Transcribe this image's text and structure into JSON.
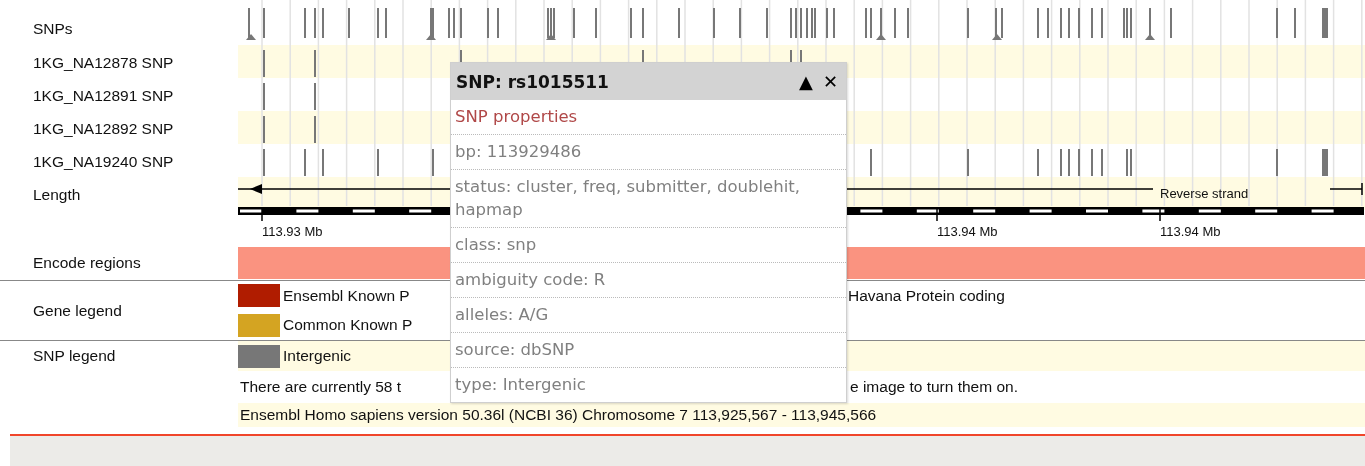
{
  "tracks": [
    {
      "label": "SNPs"
    },
    {
      "label": "1KG_NA12878 SNP"
    },
    {
      "label": "1KG_NA12891 SNP"
    },
    {
      "label": "1KG_NA12892 SNP"
    },
    {
      "label": "1KG_NA19240 SNP"
    },
    {
      "label": "Length"
    }
  ],
  "strand_note": "Reverse strand",
  "scale_labels": [
    "113.93 Mb",
    "113.94 Mb",
    "113.94 Mb"
  ],
  "encode": {
    "label": "Encode regions"
  },
  "gene_legend": {
    "label": "Gene legend",
    "items": [
      {
        "left": "Ensembl Known P",
        "right": "Havana Protein coding",
        "color": "#b01c00"
      },
      {
        "left": "Common Known P",
        "color": "#d4a422"
      }
    ]
  },
  "snp_legend": {
    "label": "SNP legend",
    "items": [
      {
        "left": "Intergenic",
        "color": "#777777"
      }
    ]
  },
  "notice": {
    "left": "There are currently 58 t",
    "right": "e image to turn them on."
  },
  "footer": "Ensembl Homo sapiens version 50.36l (NCBI 36) Chromosome 7  113,925,567 - 113,945,566",
  "popup": {
    "title": "SNP: rs1015511",
    "collapse": "▲",
    "close": "✕",
    "heading": "SNP properties",
    "rows": [
      "bp: 113929486",
      "status: cluster, freq, submitter, doublehit, hapmap",
      "class: snp",
      "ambiguity code: R",
      "alleles: A/G",
      "source: dbSNP",
      "type: Intergenic"
    ]
  }
}
